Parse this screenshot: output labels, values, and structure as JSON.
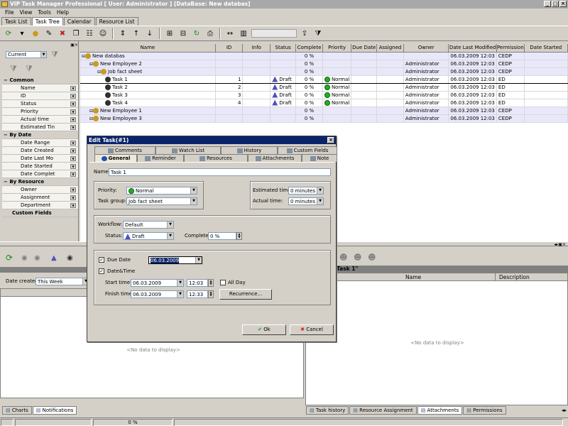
{
  "window": {
    "title": "VIP Task Manager Professional [ User: Administrator ] [DataBase: New databas]",
    "min": "_",
    "max": "□",
    "close": "×"
  },
  "menu": [
    "File",
    "View",
    "Tools",
    "Help"
  ],
  "tabs": [
    "Task List",
    "Task Tree",
    "Calendar",
    "Resource List"
  ],
  "left_panel": {
    "filter_value": "Current",
    "groups": [
      {
        "title": "Common",
        "items": [
          "Name",
          "ID",
          "Status",
          "Priority",
          "Actual time",
          "Estimated Tin"
        ]
      },
      {
        "title": "By Date",
        "items": [
          "Date Range",
          "Date Created",
          "Date Last Mo",
          "Date Started",
          "Date Complet"
        ]
      },
      {
        "title": "By Resource",
        "items": [
          "Owner",
          "Assignment",
          "Department"
        ]
      }
    ],
    "custom_fields": "Custom Fields"
  },
  "grid": {
    "columns": [
      "Name",
      "ID",
      "Info",
      "Status",
      "Complete",
      "Priority",
      "Due Date",
      "Assigned",
      "Owner",
      "Date Last Modified",
      "Permission",
      "Date Started"
    ],
    "rows": [
      {
        "name": "New databas",
        "id": "",
        "status": "",
        "complete": "0 %",
        "priority": "",
        "owner": "",
        "modified": "06.03.2009 12:03",
        "perm": "CEDP",
        "level": 0,
        "kind": "folder"
      },
      {
        "name": "New Employee 2",
        "id": "",
        "status": "",
        "complete": "0 %",
        "priority": "",
        "owner": "Administrator",
        "modified": "06.03.2009 12:03",
        "perm": "CEDP",
        "level": 1,
        "kind": "folder"
      },
      {
        "name": "Job fact sheet",
        "id": "",
        "status": "",
        "complete": "0 %",
        "priority": "",
        "owner": "Administrator",
        "modified": "06.03.2009 12:03",
        "perm": "CEDP",
        "level": 2,
        "kind": "folder"
      },
      {
        "name": "Task 1",
        "id": "1",
        "status": "Draft",
        "complete": "0 %",
        "priority": "Normal",
        "owner": "Administrator",
        "modified": "06.03.2009 12:03",
        "perm": "ED",
        "level": 3,
        "kind": "task"
      },
      {
        "name": "Task 2",
        "id": "2",
        "status": "Draft",
        "complete": "0 %",
        "priority": "Normal",
        "owner": "Administrator",
        "modified": "06.03.2009 12:03",
        "perm": "ED",
        "level": 3,
        "kind": "task"
      },
      {
        "name": "Task 3",
        "id": "3",
        "status": "Draft",
        "complete": "0 %",
        "priority": "Normal",
        "owner": "Administrator",
        "modified": "06.03.2009 12:03",
        "perm": "ED",
        "level": 3,
        "kind": "task"
      },
      {
        "name": "Task 4",
        "id": "4",
        "status": "Draft",
        "complete": "0 %",
        "priority": "Normal",
        "owner": "Administrator",
        "modified": "06.03.2009 12:03",
        "perm": "ED",
        "level": 3,
        "kind": "task"
      },
      {
        "name": "New Employee 1",
        "id": "",
        "status": "",
        "complete": "0 %",
        "priority": "",
        "owner": "Administrator",
        "modified": "06.03.2009 12:03",
        "perm": "CEDP",
        "level": 1,
        "kind": "folder"
      },
      {
        "name": "New Employee 3",
        "id": "",
        "status": "",
        "complete": "0 %",
        "priority": "",
        "owner": "Administrator",
        "modified": "06.03.2009 12:03",
        "perm": "CEDP",
        "level": 1,
        "kind": "folder"
      }
    ]
  },
  "bottom_left": {
    "date_created_label": "Date created:",
    "date_created_value": "This Week",
    "col_header": "T",
    "no_data": "<No data to display>",
    "tabs": [
      "Charts",
      "Notifications"
    ]
  },
  "bottom_right": {
    "title": "Task 1\"",
    "col_name": "Name",
    "col_desc": "Description",
    "no_data": "<No data to display>",
    "tabs": [
      "Task history",
      "Resource Assignment",
      "Attachments",
      "Permissions"
    ]
  },
  "status": {
    "progress": "0 %"
  },
  "dialog": {
    "title": "Edit Task(#1)",
    "tabs_top": [
      "Comments",
      "Watch List",
      "History",
      "Custom Fields"
    ],
    "tabs_bottom": [
      "General",
      "Reminder",
      "Resources",
      "Attachments",
      "Note"
    ],
    "name_label": "Name:",
    "name_value": "Task 1",
    "priority_label": "Priority:",
    "priority_value": "Normal",
    "taskgroup_label": "Task group:",
    "taskgroup_value": "Job fact sheet",
    "est_label": "Estimated time:",
    "est_value": "0 minutes",
    "actual_label": "Actual time:",
    "actual_value": "0 minutes",
    "workflow_label": "Workflow:",
    "workflow_value": "Default",
    "status_label": "Status:",
    "status_value": "Draft",
    "complete_label": "Complete:",
    "complete_value": "0 %",
    "due_label": "Due Date",
    "due_value": "06.03.2009",
    "datetime_label": "Date&Time",
    "start_label": "Start time:",
    "start_date": "06.03.2009",
    "start_time": "12:03",
    "allday_label": "All Day",
    "finish_label": "Finish time:",
    "finish_date": "06.03.2009",
    "finish_time": "12:33",
    "recurrence_label": "Recurrence...",
    "ok_label": "Ok",
    "cancel_label": "Cancel"
  }
}
